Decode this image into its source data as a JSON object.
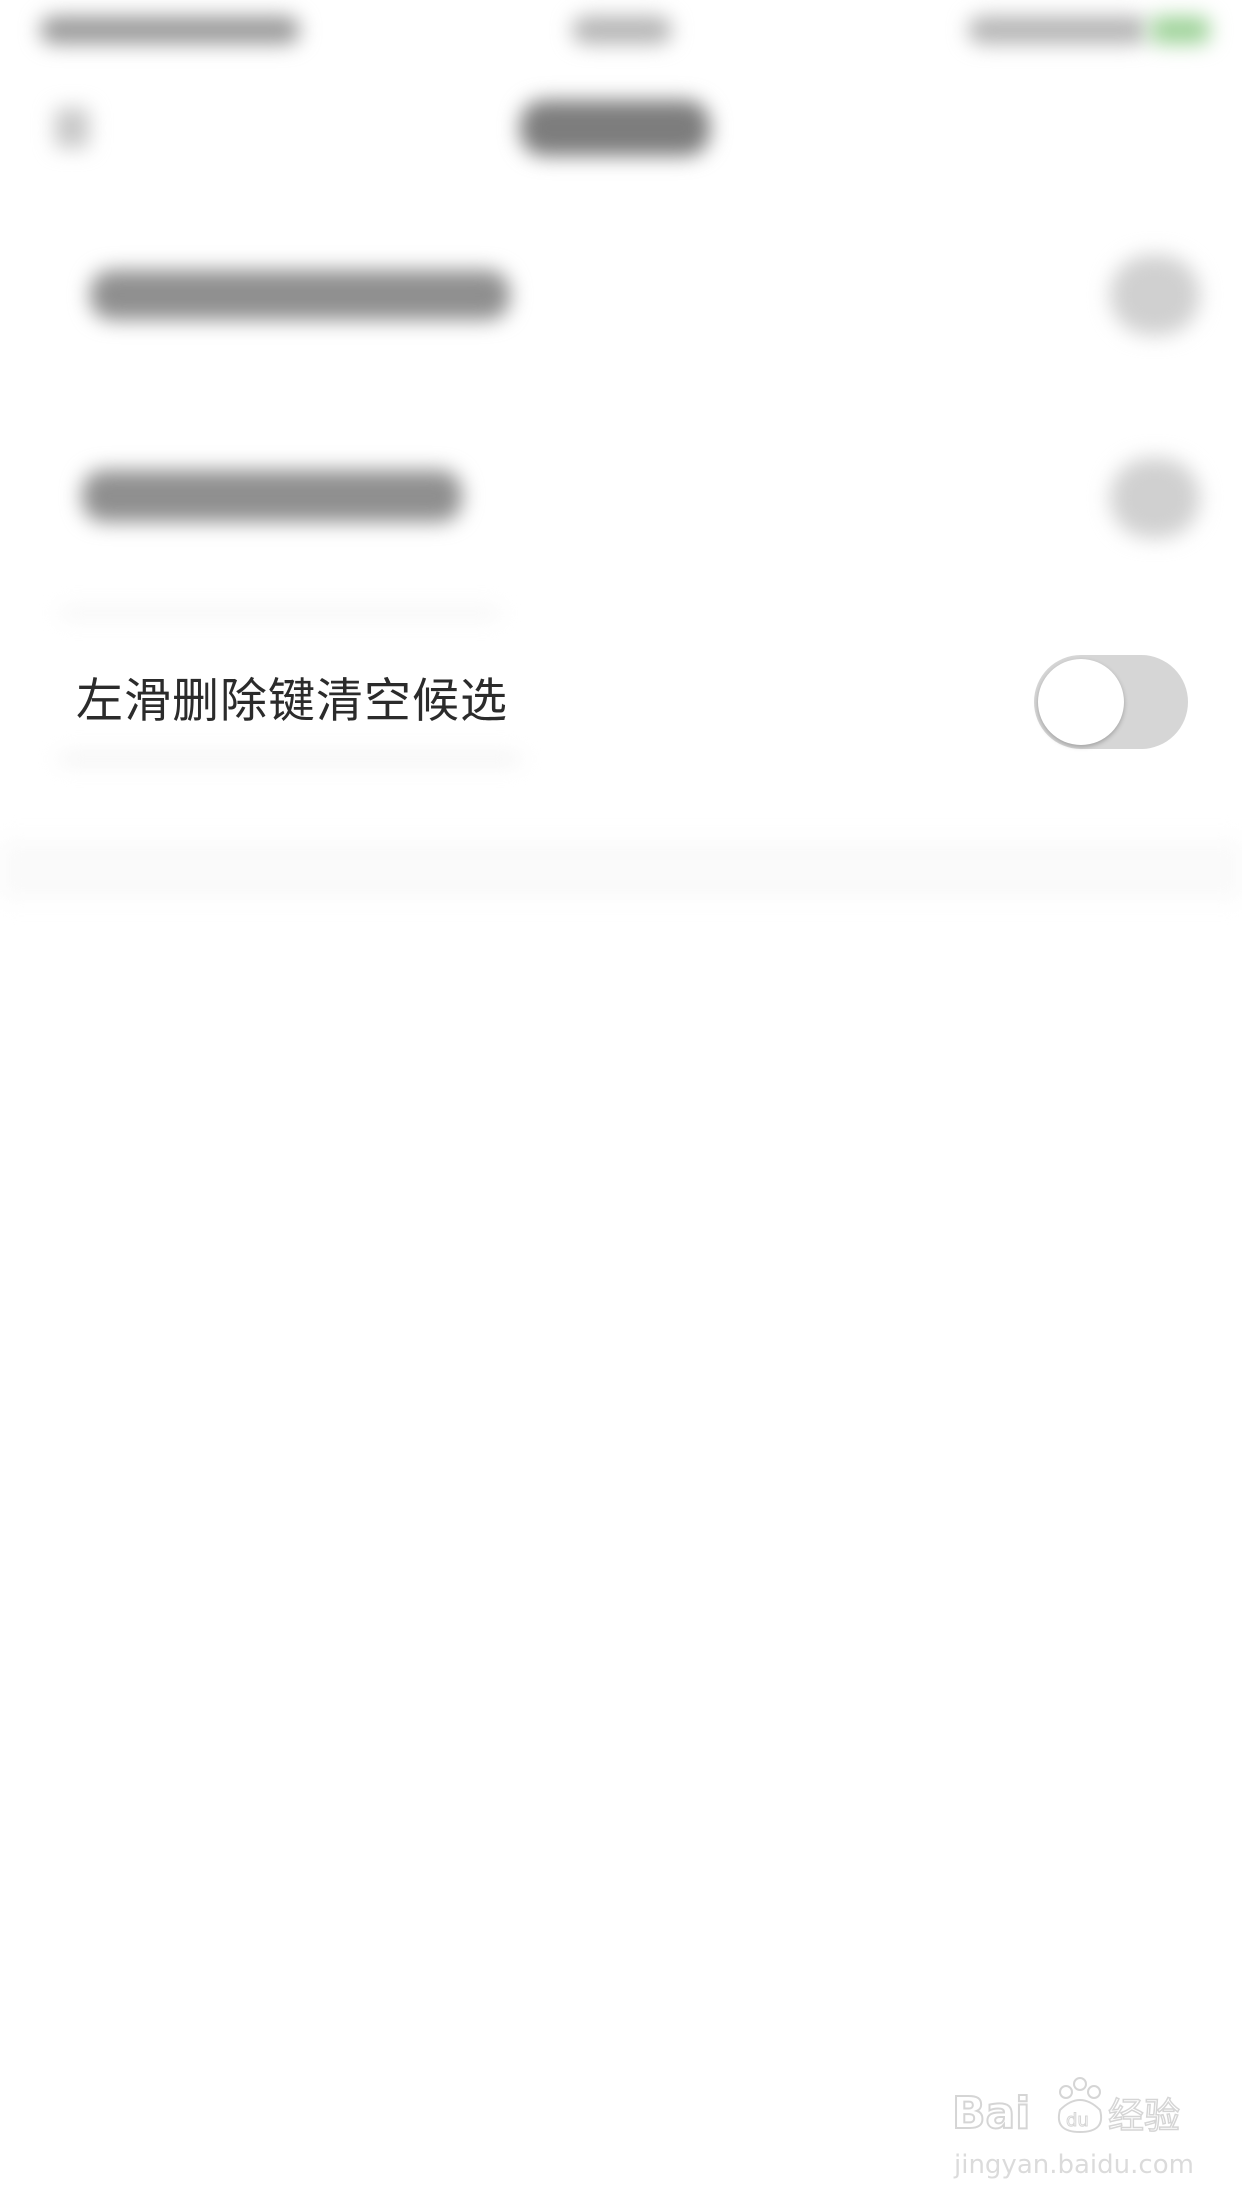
{
  "settings": {
    "rows": [
      {
        "label": "左滑删除键清空候选",
        "toggle_on": false
      }
    ]
  },
  "colors": {
    "toggle_off_track": "#d6d6d6",
    "toggle_knob": "#ffffff",
    "label_text": "#2b2b2b",
    "background": "#ffffff"
  },
  "watermark": {
    "brand": "Bai经验",
    "url": "jingyan.baidu.com"
  }
}
